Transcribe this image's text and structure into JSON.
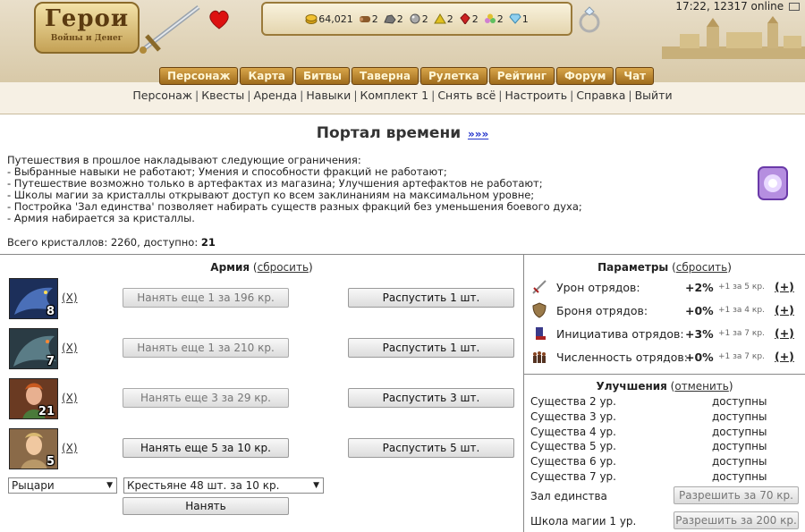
{
  "header": {
    "logo_title": "Герои",
    "logo_subtitle": "Войны и Денег",
    "clock": "17:22, 12317 online",
    "resources": [
      {
        "icon": "gold-icon",
        "value": "64,021",
        "color": "#d4a017"
      },
      {
        "icon": "wood-icon",
        "value": "2",
        "color": "#8b5a2b"
      },
      {
        "icon": "ore-icon",
        "value": "2",
        "color": "#777777"
      },
      {
        "icon": "mercury-icon",
        "value": "2",
        "color": "#9a9a9a"
      },
      {
        "icon": "sulfur-icon",
        "value": "2",
        "color": "#e0c020"
      },
      {
        "icon": "crystal-icon",
        "value": "2",
        "color": "#cc2222"
      },
      {
        "icon": "gems-icon",
        "value": "2",
        "color": "#d080d0"
      },
      {
        "icon": "diamond-icon",
        "value": "1",
        "color": "#66bbee"
      }
    ],
    "nav": [
      "Персонаж",
      "Карта",
      "Битвы",
      "Таверна",
      "Рулетка",
      "Рейтинг",
      "Форум",
      "Чат"
    ],
    "subnav": [
      "Персонаж",
      "Квесты",
      "Аренда",
      "Навыки",
      "Комплект 1",
      "Снять всё",
      "Настроить",
      "Справка",
      "Выйти"
    ]
  },
  "page": {
    "title": "Портал времени",
    "title_link": "»»»",
    "restrictions": [
      "Путешествия в прошлое накладывают следующие ограничения:",
      "- Выбранные навыки не работают; Умения и способности фракций не работают;",
      "- Путешествие возможно только в артефактах из магазина; Улучшения артефактов не работают;",
      "- Школы магии за кристаллы открывают доступ ко всем заклинаниям на максимальном уровне;",
      "- Постройка 'Зал единства' позволяет набирать существ разных фракций без уменьшения боевого духа;",
      "- Армия набирается за кристаллы."
    ],
    "crystals_label": "Всего кристаллов: 2260, доступно:",
    "crystals_available": "21"
  },
  "army": {
    "title": "Армия",
    "reset": "сбросить",
    "units": [
      {
        "count": "8",
        "remove": "(X)",
        "hire": "Нанять еще 1 за 196 кр.",
        "hire_enabled": false,
        "dismiss": "Распустить 1 шт.",
        "color": "#2c4a8a"
      },
      {
        "count": "7",
        "remove": "(X)",
        "hire": "Нанять еще 1 за 210 кр.",
        "hire_enabled": false,
        "dismiss": "Распустить 1 шт.",
        "color": "#3a5a6a"
      },
      {
        "count": "21",
        "remove": "(X)",
        "hire": "Нанять еще 3 за 29 кр.",
        "hire_enabled": false,
        "dismiss": "Распустить 3 шт.",
        "color": "#8a4a2a"
      },
      {
        "count": "5",
        "remove": "(X)",
        "hire": "Нанять еще 5 за 10 кр.",
        "hire_enabled": true,
        "dismiss": "Распустить 5 шт.",
        "color": "#7a5a3a"
      }
    ],
    "faction_select": "Рыцари",
    "unit_select": "Крестьяне 48 шт. за 10 кр.",
    "hire_button": "Нанять"
  },
  "params": {
    "title": "Параметры",
    "reset": "сбросить",
    "plus": "(+)",
    "items": [
      {
        "icon": "sword-damage-icon",
        "label": "Урон отрядов:",
        "value": "+2%",
        "cost": "+1 за 5 кр."
      },
      {
        "icon": "shield-armor-icon",
        "label": "Броня отрядов:",
        "value": "+0%",
        "cost": "+1 за 4 кр."
      },
      {
        "icon": "boot-initiative-icon",
        "label": "Инициатива отрядов:",
        "value": "+3%",
        "cost": "+1 за 7 кр."
      },
      {
        "icon": "troops-size-icon",
        "label": "Численность отрядов:",
        "value": "+0%",
        "cost": "+1 за 7 кр."
      }
    ]
  },
  "upgrades": {
    "title": "Улучшения",
    "cancel": "отменить",
    "creatures": [
      {
        "name": "Существа 2 ур.",
        "status": "доступны"
      },
      {
        "name": "Существа 3 ур.",
        "status": "доступны"
      },
      {
        "name": "Существа 4 ур.",
        "status": "доступны"
      },
      {
        "name": "Существа 5 ур.",
        "status": "доступны"
      },
      {
        "name": "Существа 6 ур.",
        "status": "доступны"
      },
      {
        "name": "Существа 7 ур.",
        "status": "доступны"
      }
    ],
    "buildings": [
      {
        "name": "Зал единства",
        "button": "Разрешить за 70 кр."
      },
      {
        "name": "Школа магии 1 ур.",
        "button": "Разрешить за 200 кр."
      }
    ]
  }
}
